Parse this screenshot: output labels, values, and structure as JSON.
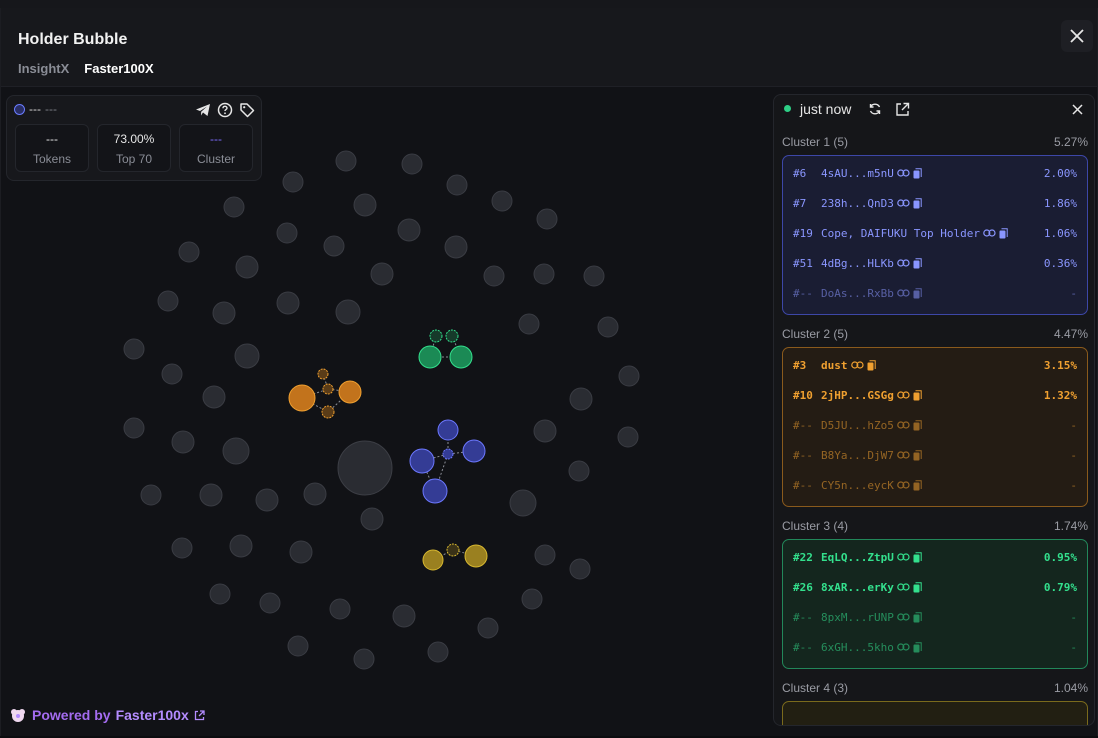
{
  "header": {
    "title": "Holder Bubble",
    "tabs": [
      "InsightX",
      "Faster100X"
    ],
    "active_tab": 1
  },
  "token": {
    "name": "---",
    "symbol": "---",
    "stats": [
      {
        "value": "---",
        "label": "Tokens"
      },
      {
        "value": "73.00%",
        "label": "Top 70"
      },
      {
        "value": "---",
        "label": "Cluster"
      }
    ]
  },
  "footer": {
    "prefix": "Powered by",
    "brand": "Faster100x"
  },
  "panel": {
    "status": "just now",
    "clusters": [
      {
        "title": "Cluster 1 (5)",
        "pct": "5.27%",
        "rows": [
          {
            "rank": "#6",
            "addr": "4sAU...m5nU",
            "pct": "2.00%",
            "dim": false
          },
          {
            "rank": "#7",
            "addr": "238h...QnD3",
            "pct": "1.86%",
            "dim": false
          },
          {
            "rank": "#19",
            "addr": "Cope, DAIFUKU Top Holder",
            "pct": "1.06%",
            "dim": false
          },
          {
            "rank": "#51",
            "addr": "4dBg...HLKb",
            "pct": "0.36%",
            "dim": false
          },
          {
            "rank": "#--",
            "addr": "DoAs...RxBb",
            "pct": "-",
            "dim": true
          }
        ]
      },
      {
        "title": "Cluster 2 (5)",
        "pct": "4.47%",
        "rows": [
          {
            "rank": "#3",
            "addr": "dust",
            "pct": "3.15%",
            "dim": false
          },
          {
            "rank": "#10",
            "addr": "2jHP...GSGg",
            "pct": "1.32%",
            "dim": false
          },
          {
            "rank": "#--",
            "addr": "D5JU...hZo5",
            "pct": "-",
            "dim": true
          },
          {
            "rank": "#--",
            "addr": "B8Ya...DjW7",
            "pct": "-",
            "dim": true
          },
          {
            "rank": "#--",
            "addr": "CY5n...eycK",
            "pct": "-",
            "dim": true
          }
        ]
      },
      {
        "title": "Cluster 3 (4)",
        "pct": "1.74%",
        "rows": [
          {
            "rank": "#22",
            "addr": "EqLQ...ZtpU",
            "pct": "0.95%",
            "dim": false
          },
          {
            "rank": "#26",
            "addr": "8xAR...erKy",
            "pct": "0.79%",
            "dim": false
          },
          {
            "rank": "#--",
            "addr": "8pxM...rUNP",
            "pct": "-",
            "dim": true
          },
          {
            "rank": "#--",
            "addr": "6xGH...5kho",
            "pct": "-",
            "dim": true
          }
        ]
      },
      {
        "title": "Cluster 4 (3)",
        "pct": "1.04%",
        "rows": []
      }
    ]
  },
  "colors": {
    "cluster1": "#4a55c8",
    "cluster2": "#d8801e",
    "cluster3": "#1fa866",
    "cluster4": "#b89a22",
    "bubble": "#2b2d33"
  }
}
